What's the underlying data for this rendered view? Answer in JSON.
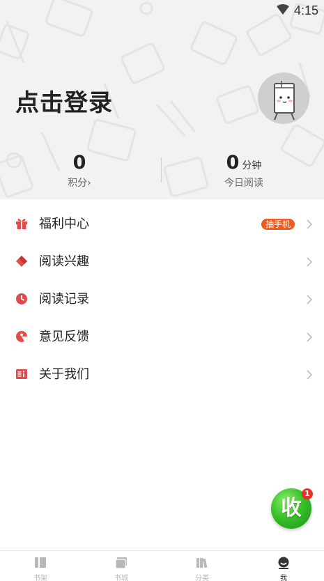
{
  "status_bar": {
    "time": "4:15"
  },
  "header": {
    "login_text": "点击登录",
    "stats": {
      "points": {
        "value": "0",
        "label": "积分›"
      },
      "reading_today": {
        "value": "0",
        "unit": "分钟",
        "label": "今日阅读"
      }
    }
  },
  "menu": {
    "items": [
      {
        "label": "福利中心",
        "badge": "抽手机",
        "icon": "gift-icon"
      },
      {
        "label": "阅读兴趣",
        "icon": "heart-tag-icon"
      },
      {
        "label": "阅读记录",
        "icon": "clock-icon"
      },
      {
        "label": "意见反馈",
        "icon": "feedback-icon"
      },
      {
        "label": "关于我们",
        "icon": "info-icon"
      }
    ]
  },
  "floating_button": {
    "label": "收",
    "badge_count": "1"
  },
  "bottom_nav": {
    "items": [
      {
        "label": "书架",
        "icon": "bookshelf-icon"
      },
      {
        "label": "书城",
        "icon": "bookstore-icon"
      },
      {
        "label": "分类",
        "icon": "category-icon"
      },
      {
        "label": "我",
        "icon": "profile-icon",
        "active": true
      }
    ]
  },
  "colors": {
    "accent_red": "#e04b4b",
    "badge_orange": "#f25a1b",
    "fab_green": "#39c12a"
  }
}
